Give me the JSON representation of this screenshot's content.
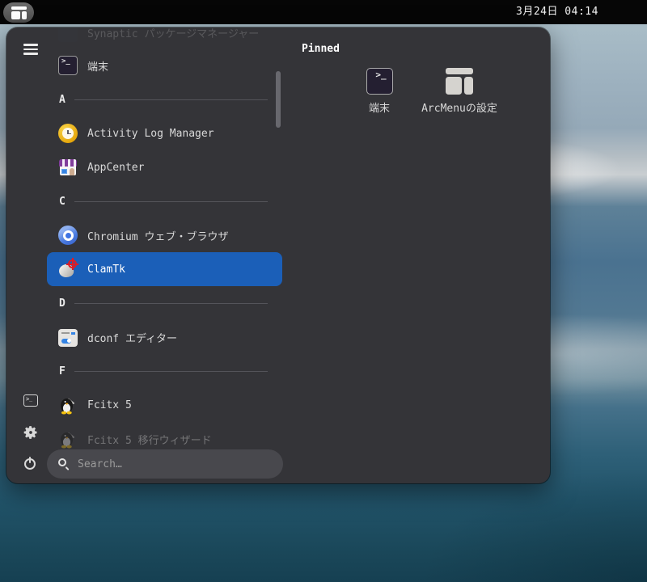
{
  "topbar": {
    "clock": "3月24日 04:14"
  },
  "icons": {
    "terminal_prompt_glyph": ">_"
  },
  "colors": {
    "topbar_bg": "#060606",
    "menu_bg": "#343438",
    "selection_blue": "#1b5fb8",
    "search_bg": "#48484d",
    "clamtk_crosshair_red": "#e01b24",
    "chromium_blue": "#4a7be0",
    "activity_gold": "#e5a50a",
    "appcenter_purple": "#813d9c"
  },
  "menu": {
    "sidebar": {
      "items": [
        {
          "name": "hamburger-menu"
        },
        {
          "name": "terminal-shortcut"
        },
        {
          "name": "settings"
        },
        {
          "name": "power"
        }
      ]
    },
    "app_list": {
      "items": [
        {
          "type": "app",
          "label": "Synaptic パッケージマネージャー",
          "icon": "synaptic-icon",
          "state": "cut-off-faded"
        },
        {
          "type": "app",
          "label": "端末",
          "icon": "terminal-icon"
        },
        {
          "type": "section",
          "label": "A"
        },
        {
          "type": "app",
          "label": "Activity Log Manager",
          "icon": "activity-log-manager-icon"
        },
        {
          "type": "app",
          "label": "AppCenter",
          "icon": "appcenter-icon"
        },
        {
          "type": "section",
          "label": "C"
        },
        {
          "type": "app",
          "label": "Chromium ウェブ・ブラウザ",
          "icon": "chromium-icon"
        },
        {
          "type": "app",
          "label": "ClamTk",
          "icon": "clamtk-icon",
          "selected": true
        },
        {
          "type": "section",
          "label": "D"
        },
        {
          "type": "app",
          "label": "dconf エディター",
          "icon": "dconf-editor-icon"
        },
        {
          "type": "section",
          "label": "F"
        },
        {
          "type": "app",
          "label": "Fcitx 5",
          "icon": "fcitx-icon"
        },
        {
          "type": "app",
          "label": "Fcitx 5 移行ウィザード",
          "icon": "fcitx-icon",
          "state": "dimmed"
        }
      ]
    },
    "search": {
      "placeholder": "Search…"
    },
    "pinned": {
      "header": "Pinned",
      "items": [
        {
          "label": "端末",
          "icon": "terminal-icon"
        },
        {
          "label": "ArcMenuの設定",
          "icon": "arcmenu-icon"
        }
      ]
    }
  }
}
